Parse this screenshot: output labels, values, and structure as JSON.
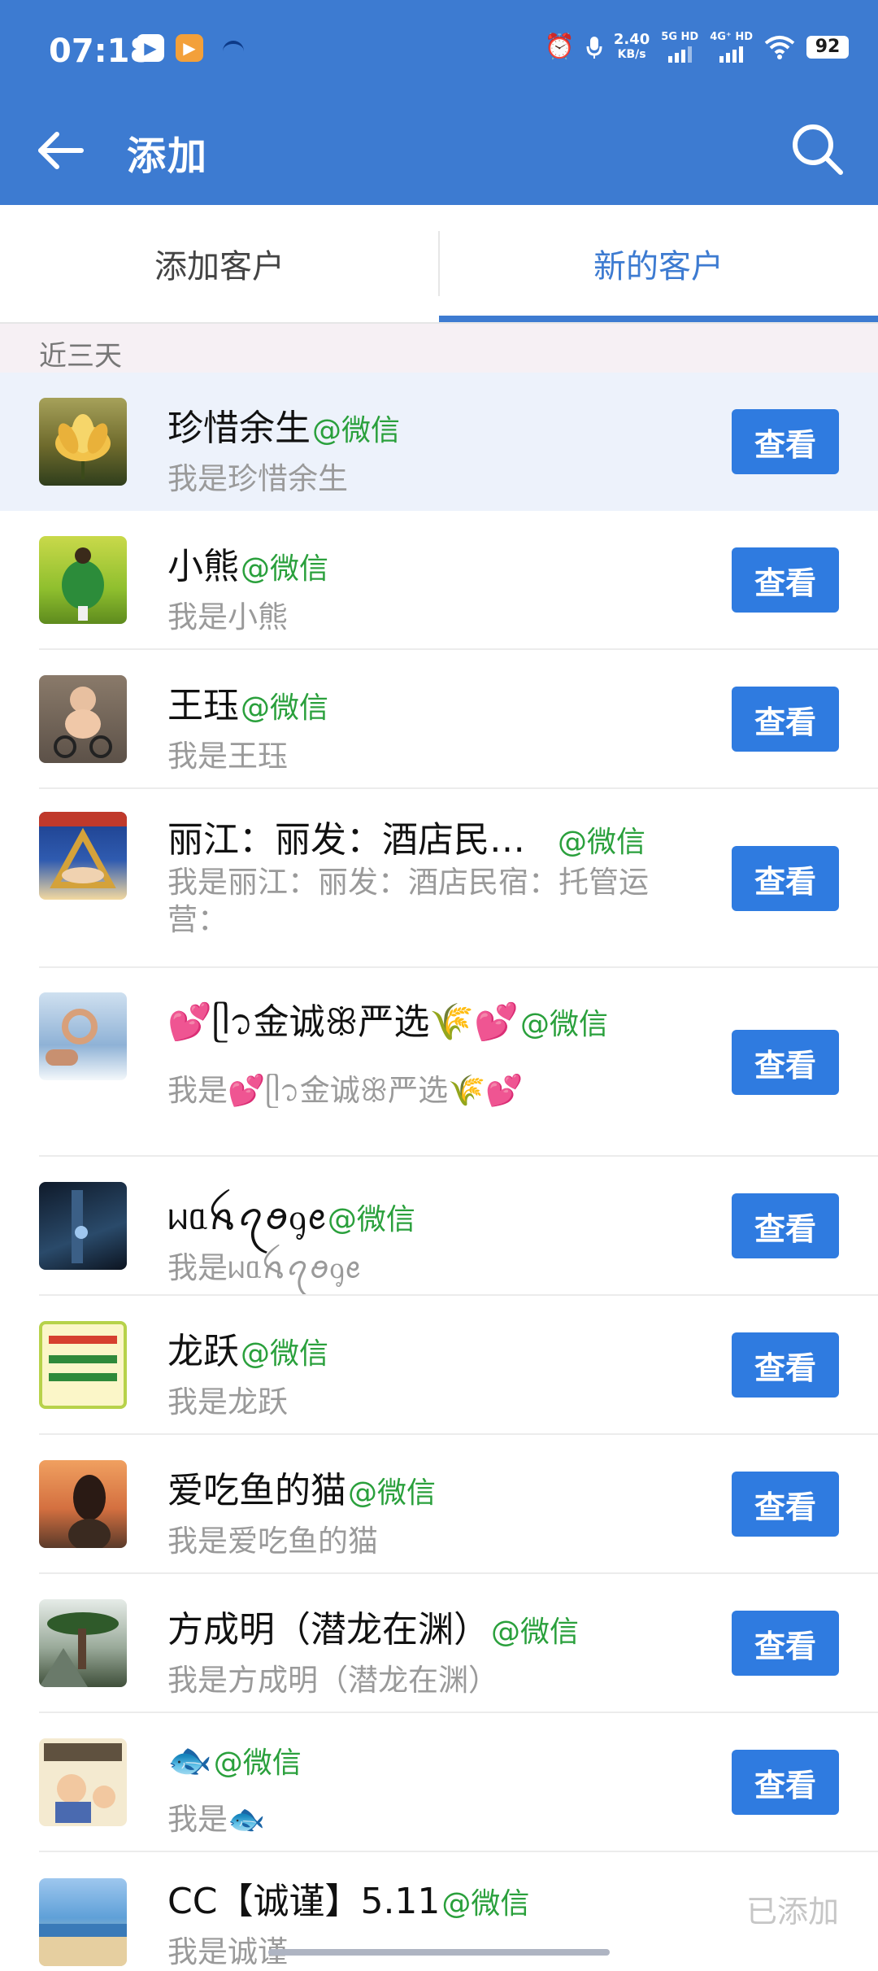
{
  "status_bar": {
    "time": "07:18",
    "net_speed": "2.40",
    "net_unit": "KB/s",
    "sim1": "5G HD",
    "sim2": "4G⁺ HD",
    "battery": "92"
  },
  "header": {
    "title": "添加"
  },
  "tabs": [
    {
      "label": "添加客户"
    },
    {
      "label": "新的客户"
    }
  ],
  "section_title": "近三天",
  "source_label": "@微信",
  "action_label": "查看",
  "added_label": "已添加",
  "contacts": [
    {
      "name": "珍惜余生",
      "message": "我是珍惜余生"
    },
    {
      "name": "小熊",
      "message": "我是小熊"
    },
    {
      "name": "王珏",
      "message": "我是王珏"
    },
    {
      "name": "丽江：丽发：酒店民…",
      "message": "我是丽江：丽发：酒店民宿：托管运营："
    },
    {
      "name": "💕ᥫ᭡金诚ꕥ严选🌾💕",
      "message": "我是💕ᥫ᭡金诚ꕥ严选🌾💕"
    },
    {
      "name": "ᥕᥲꫝꪖꪮᧁꫀ",
      "message": "我是ᥕᥲꫝꪖꪮᧁꫀ"
    },
    {
      "name": "龙跃",
      "message": "我是龙跃"
    },
    {
      "name": "爱吃鱼的猫",
      "message": "我是爱吃鱼的猫"
    },
    {
      "name": "方成明（潜龙在渊）",
      "message": "我是方成明（潜龙在渊）"
    },
    {
      "name": "🐟",
      "message": "我是🐟"
    },
    {
      "name": "CC【诚谨】5.11",
      "message": "我是诚谨"
    }
  ]
}
